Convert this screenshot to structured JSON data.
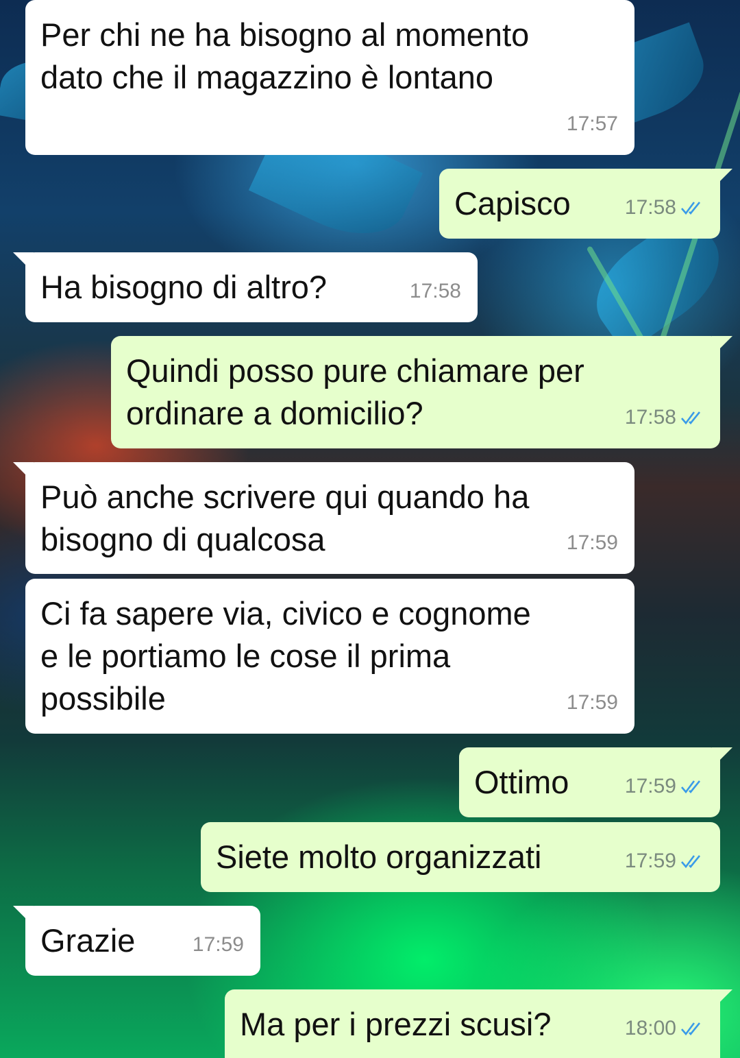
{
  "conversation": {
    "messages": [
      {
        "direction": "in",
        "text": "Per chi ne ha bisogno al momento\ndato che il magazzino è lontano",
        "time": "17:57"
      },
      {
        "direction": "out",
        "text": "Capisco",
        "time": "17:58",
        "status": "read"
      },
      {
        "direction": "in",
        "text": "Ha bisogno di altro?",
        "time": "17:58"
      },
      {
        "direction": "out",
        "text": "Quindi posso pure chiamare per\nordinare a domicilio?",
        "time": "17:58",
        "status": "read"
      },
      {
        "direction": "in",
        "text": "Può anche scrivere qui quando ha\nbisogno di qualcosa",
        "time": "17:59"
      },
      {
        "direction": "in",
        "text": "Ci fa sapere via, civico e cognome\ne le portiamo le cose il prima\npossibile",
        "time": "17:59"
      },
      {
        "direction": "out",
        "text": "Ottimo",
        "time": "17:59",
        "status": "read"
      },
      {
        "direction": "out",
        "text": "Siete molto organizzati",
        "time": "17:59",
        "status": "read"
      },
      {
        "direction": "in",
        "text": "Grazie",
        "time": "17:59"
      },
      {
        "direction": "out",
        "text": "Ma per i prezzi scusi?",
        "time": "18:00",
        "status": "read"
      }
    ]
  },
  "colors": {
    "incoming_bubble": "#ffffff",
    "outgoing_bubble": "#e6ffcc",
    "read_ticks": "#3a9be8",
    "timestamp": "#8c8c8c"
  },
  "icons": {
    "read_receipt": "double-check-icon"
  }
}
